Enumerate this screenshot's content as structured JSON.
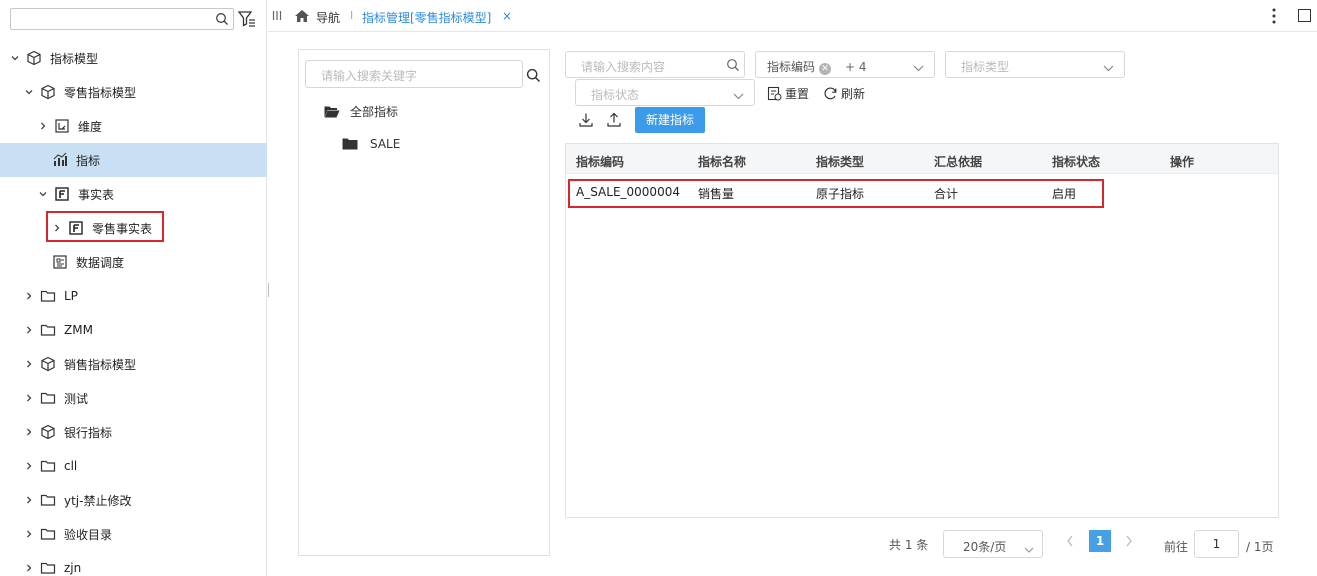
{
  "sidebar": {
    "search_placeholder": "",
    "items": [
      {
        "label": "指标模型"
      },
      {
        "label": "零售指标模型"
      },
      {
        "label": "维度"
      },
      {
        "label": "指标"
      },
      {
        "label": "事实表"
      },
      {
        "label": "零售事实表"
      },
      {
        "label": "数据调度"
      },
      {
        "label": "LP"
      },
      {
        "label": "ZMM"
      },
      {
        "label": "销售指标模型"
      },
      {
        "label": "测试"
      },
      {
        "label": "银行指标"
      },
      {
        "label": "cll"
      },
      {
        "label": "ytj-禁止修改"
      },
      {
        "label": "验收目录"
      },
      {
        "label": "zjn"
      }
    ]
  },
  "topbar": {
    "nav_label": "导航",
    "separator": "I",
    "active_tab": "指标管理[零售指标模型]",
    "close_glyph": "×"
  },
  "catalog": {
    "search_placeholder": "请输入搜索关键字",
    "items": [
      {
        "label": "全部指标"
      },
      {
        "label": "SALE"
      }
    ]
  },
  "filters": {
    "search_placeholder": "请输入搜索内容",
    "code_tag": "指标编码",
    "code_more": "+ 4",
    "type_placeholder": "指标类型",
    "status_placeholder": "指标状态",
    "reset_label": "重置",
    "refresh_label": "刷新",
    "new_button": "新建指标"
  },
  "table": {
    "headers": [
      "指标编码",
      "指标名称",
      "指标类型",
      "汇总依据",
      "指标状态",
      "操作"
    ],
    "rows": [
      {
        "code": "A_SALE_0000004",
        "name": "销售量",
        "type": "原子指标",
        "agg": "合计",
        "status": "启用",
        "ops": ""
      }
    ]
  },
  "pager": {
    "total": "共 1 条",
    "page_size": "20条/页",
    "current_page": "1",
    "goto_label": "前往",
    "goto_value": "1",
    "page_total": "/ 1页"
  },
  "colors": {
    "accent": "#3c9be8",
    "active_tab": "#2d8ae0",
    "selected_row": "#c9dff3",
    "highlight": "#d9262c"
  }
}
